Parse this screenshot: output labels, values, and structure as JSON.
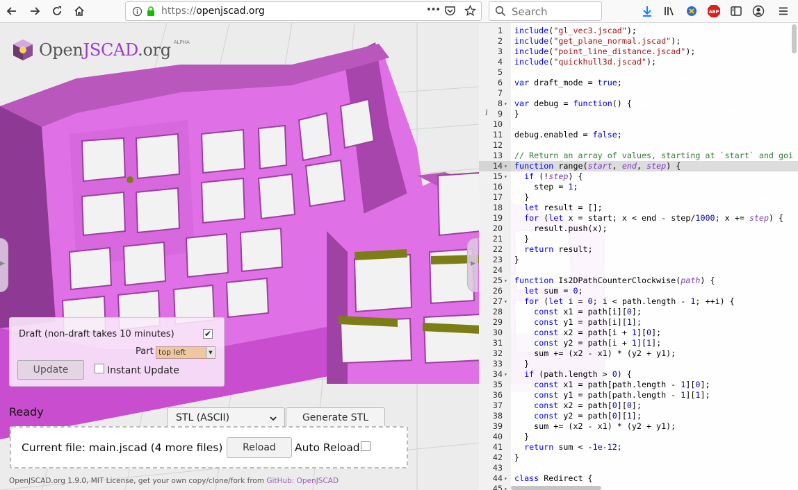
{
  "browser": {
    "url_protocol": "https://",
    "url_host": "openjscad.org",
    "search_placeholder": "Search",
    "page_actions": "•••",
    "abp": "ABP"
  },
  "logo": {
    "open": "Open",
    "jscad": "JSCAD",
    "org": ".org",
    "alpha": "ALPHA"
  },
  "params": {
    "draft_label": "Draft (non-draft takes 10 minutes)",
    "draft_checked": true,
    "part_label": "Part",
    "part_value": "top left",
    "update_label": "Update",
    "instant_label": "Instant Update",
    "instant_checked": false
  },
  "status": "Ready",
  "export": {
    "format": "STL (ASCII)",
    "generate_label": "Generate STL"
  },
  "file": {
    "current": "Current file: main.jscad (4 more files)",
    "reload_label": "Reload",
    "auto_reload_label": "Auto Reload",
    "auto_reload_checked": false
  },
  "footer": {
    "text": "OpenJSCAD.org 1.9.0, MIT License, get your own copy/clone/fork from ",
    "link": "GitHub: OpenJSCAD"
  },
  "editor": {
    "lines": [
      {
        "n": "1",
        "f": "",
        "t": "include(\"gl_vec3.jscad\");"
      },
      {
        "n": "2",
        "f": "",
        "t": "include(\"get_plane_normal.jscad\");"
      },
      {
        "n": "3",
        "f": "",
        "t": "include(\"point_line_distance.jscad\");"
      },
      {
        "n": "4",
        "f": "",
        "t": "include(\"quickhull3d.jscad\");"
      },
      {
        "n": "5",
        "f": "",
        "t": ""
      },
      {
        "n": "6",
        "f": "",
        "t": "var draft_mode = true;"
      },
      {
        "n": "7",
        "f": "",
        "t": ""
      },
      {
        "n": "8",
        "f": "▾",
        "t": "var debug = function() {"
      },
      {
        "n": "9",
        "f": "",
        "t": "}"
      },
      {
        "n": "10",
        "f": "",
        "t": ""
      },
      {
        "n": "11",
        "f": "",
        "t": "debug.enabled = false;"
      },
      {
        "n": "12",
        "f": "",
        "t": ""
      },
      {
        "n": "13",
        "f": "",
        "t": "// Return an array of values, starting at `start` and goi"
      },
      {
        "n": "14",
        "f": "▾",
        "t": "function range(start, end, step) {"
      },
      {
        "n": "15",
        "f": "▾",
        "t": "  if (!step) {"
      },
      {
        "n": "16",
        "f": "",
        "t": "    step = 1;"
      },
      {
        "n": "17",
        "f": "",
        "t": "  }"
      },
      {
        "n": "18",
        "f": "",
        "t": "  let result = [];"
      },
      {
        "n": "19",
        "f": "",
        "t": "  for (let x = start; x < end - step/1000; x += step) {"
      },
      {
        "n": "20",
        "f": "",
        "t": "    result.push(x);"
      },
      {
        "n": "21",
        "f": "",
        "t": "  }"
      },
      {
        "n": "22",
        "f": "",
        "t": "  return result;"
      },
      {
        "n": "23",
        "f": "",
        "t": "}"
      },
      {
        "n": "24",
        "f": "",
        "t": ""
      },
      {
        "n": "25",
        "f": "▾",
        "t": "function Is2DPathCounterClockwise(path) {"
      },
      {
        "n": "26",
        "f": "",
        "t": "  let sum = 0;"
      },
      {
        "n": "27",
        "f": "▾",
        "t": "  for (let i = 0; i < path.length - 1; ++i) {"
      },
      {
        "n": "28",
        "f": "",
        "t": "    const x1 = path[i][0];"
      },
      {
        "n": "29",
        "f": "",
        "t": "    const y1 = path[i][1];"
      },
      {
        "n": "30",
        "f": "",
        "t": "    const x2 = path[i + 1][0];"
      },
      {
        "n": "31",
        "f": "",
        "t": "    const y2 = path[i + 1][1];"
      },
      {
        "n": "32",
        "f": "",
        "t": "    sum += (x2 - x1) * (y2 + y1);"
      },
      {
        "n": "33",
        "f": "",
        "t": "  }"
      },
      {
        "n": "34",
        "f": "▾",
        "t": "  if (path.length > 0) {"
      },
      {
        "n": "35",
        "f": "",
        "t": "    const x1 = path[path.length - 1][0];"
      },
      {
        "n": "36",
        "f": "",
        "t": "    const y1 = path[path.length - 1][1];"
      },
      {
        "n": "37",
        "f": "",
        "t": "    const x2 = path[0][0];"
      },
      {
        "n": "38",
        "f": "",
        "t": "    const y2 = path[0][1];"
      },
      {
        "n": "39",
        "f": "",
        "t": "    sum += (x2 - x1) * (y2 + y1);"
      },
      {
        "n": "40",
        "f": "",
        "t": "  }"
      },
      {
        "n": "41",
        "f": "",
        "t": "  return sum < -1e-12;"
      },
      {
        "n": "42",
        "f": "",
        "t": "}"
      },
      {
        "n": "43",
        "f": "",
        "t": ""
      },
      {
        "n": "44",
        "f": "▾",
        "t": "class Redirect {"
      },
      {
        "n": "45",
        "f": "▾",
        "t": ""
      }
    ],
    "highlight_line": "14"
  },
  "colors": {
    "model": "#e372e8",
    "model_dark": "#9b3fa0",
    "accent": "#9b3bd2",
    "pad": "#7d7d16"
  }
}
